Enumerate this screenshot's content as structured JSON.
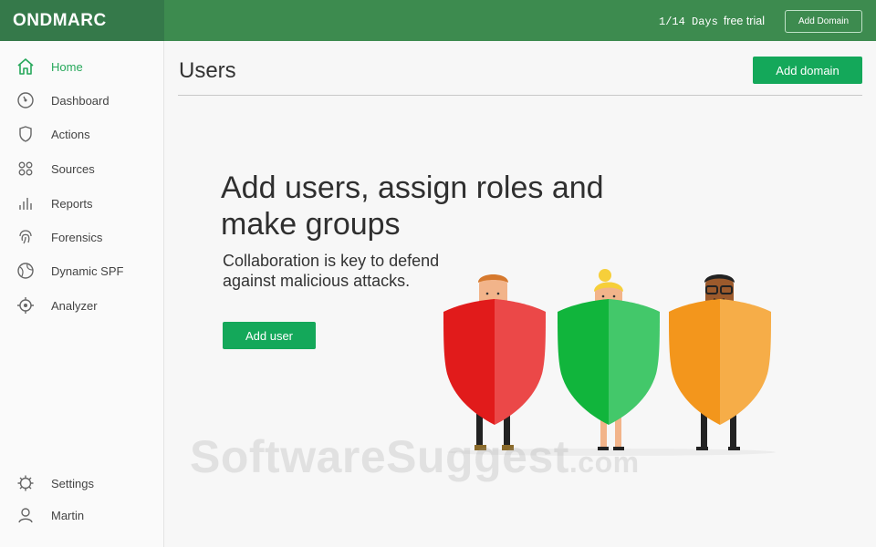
{
  "topbar": {
    "logo": "ONDMARC",
    "trial_counter": "1/14 Days",
    "trial_label": "free trial",
    "add_domain_label": "Add Domain"
  },
  "sidebar": {
    "items": [
      {
        "label": "Home",
        "icon": "home-icon",
        "active": true
      },
      {
        "label": "Dashboard",
        "icon": "dashboard-icon"
      },
      {
        "label": "Actions",
        "icon": "shield-icon"
      },
      {
        "label": "Sources",
        "icon": "grid-icon"
      },
      {
        "label": "Reports",
        "icon": "bar-chart-icon"
      },
      {
        "label": "Forensics",
        "icon": "fingerprint-icon"
      },
      {
        "label": "Dynamic SPF",
        "icon": "globe-icon"
      },
      {
        "label": "Analyzer",
        "icon": "target-icon"
      }
    ],
    "bottom": [
      {
        "label": "Settings",
        "icon": "gear-icon"
      },
      {
        "label": "Martin",
        "icon": "user-icon"
      }
    ]
  },
  "main": {
    "title": "Users",
    "add_domain_button": "Add domain",
    "headline": "Add users, assign roles and make groups",
    "subline": "Collaboration is key to defend against malicious attacks.",
    "add_user_button": "Add user"
  },
  "watermark": {
    "main": "SoftwareSuggest",
    "suffix": ".com"
  },
  "colors": {
    "brand_green": "#3d8b4f",
    "button_green": "#14a85a",
    "active_text": "#27a85b"
  }
}
